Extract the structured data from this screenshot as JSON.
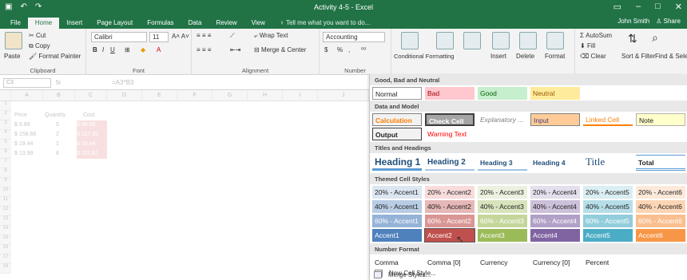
{
  "window": {
    "title": "Activity 4-5 - Excel",
    "user": "John Smith",
    "share": "Share"
  },
  "tabs": [
    {
      "label": "File"
    },
    {
      "label": "Home"
    },
    {
      "label": "Insert"
    },
    {
      "label": "Page Layout"
    },
    {
      "label": "Formulas"
    },
    {
      "label": "Data"
    },
    {
      "label": "Review"
    },
    {
      "label": "View"
    },
    {
      "label": "Tell me what you want to do..."
    }
  ],
  "ribbon": {
    "clipboard": {
      "paste": "Paste",
      "cut": "Cut",
      "copy": "Copy",
      "format_painter": "Format Painter",
      "label": "Clipboard"
    },
    "font": {
      "name": "Calibri",
      "size": "11",
      "label": "Font"
    },
    "alignment": {
      "wrap": "Wrap Text",
      "merge": "Merge & Center",
      "label": "Alignment"
    },
    "number": {
      "format": "Accounting",
      "label": "Number",
      "currency": "$",
      "percent": "%",
      "comma": ","
    },
    "styles": {
      "conditional": "Conditional Formatting",
      "format_table": "Format as Table",
      "cell_styles": "Cell Styles"
    },
    "cells": {
      "insert": "Insert",
      "delete": "Delete",
      "format": "Format"
    },
    "editing": {
      "autosum": "AutoSum",
      "fill": "Fill",
      "clear": "Clear",
      "sort": "Sort & Filter",
      "find": "Find & Select"
    }
  },
  "formula": {
    "namebox": "C3",
    "fx": "fx",
    "value": "=A3*B3"
  },
  "sheet": {
    "columns": [
      "A",
      "B",
      "C",
      "D",
      "E",
      "F",
      "G",
      "H",
      "I",
      "J"
    ],
    "rows": [
      "1",
      "2",
      "3",
      "4",
      "5",
      "6",
      "7",
      "8",
      "9",
      "10",
      "11",
      "12",
      "13",
      "14",
      "15",
      "16",
      "17",
      "18"
    ],
    "cells": [
      {
        "a": "Price",
        "b": "Quantity",
        "c": "Cost"
      },
      {
        "a": "$ 9.99",
        "b": "5",
        "c": "$ 49.95"
      },
      {
        "a": "$ 158.66",
        "b": "2",
        "c": "$ 317.32"
      },
      {
        "a": "$ 19.44",
        "b": "1",
        "c": "$ 19.44"
      },
      {
        "a": "$ 13.99",
        "b": "8",
        "c": "$ 111.92"
      }
    ]
  },
  "gallery": {
    "sec_good_bad": "Good, Bad and Neutral",
    "normal": "Normal",
    "bad": "Bad",
    "good": "Good",
    "neutral": "Neutral",
    "sec_data": "Data and Model",
    "calculation": "Calculation",
    "check_cell": "Check Cell",
    "explanatory": "Explanatory ...",
    "input": "Input",
    "linked": "Linked Cell",
    "note": "Note",
    "output": "Output",
    "warning": "Warning Text",
    "sec_titles": "Titles and Headings",
    "h1": "Heading 1",
    "h2": "Heading 2",
    "h3": "Heading 3",
    "h4": "Heading 4",
    "title": "Title",
    "total": "Total",
    "sec_themed": "Themed Cell Styles",
    "t20": [
      "20% - Accent1",
      "20% - Accent2",
      "20% - Accent3",
      "20% - Accent4",
      "20% - Accent5",
      "20% - Accent6"
    ],
    "t40": [
      "40% - Accent1",
      "40% - Accent2",
      "40% - Accent3",
      "40% - Accent4",
      "40% - Accent5",
      "40% - Accent6"
    ],
    "t60": [
      "60% - Accent1",
      "60% - Accent2",
      "60% - Accent3",
      "60% - Accent4",
      "60% - Accent5",
      "60% - Accent6"
    ],
    "acc": [
      "Accent1",
      "Accent2",
      "Accent3",
      "Accent4",
      "Accent5",
      "Accent6"
    ],
    "sec_number": "Number Format",
    "num": [
      "Comma",
      "Comma [0]",
      "Currency",
      "Currency [0]",
      "Percent"
    ],
    "new_style": "New Cell Style...",
    "merge_styles": "Merge Styles..."
  },
  "colors": {
    "brand": "#217346"
  }
}
